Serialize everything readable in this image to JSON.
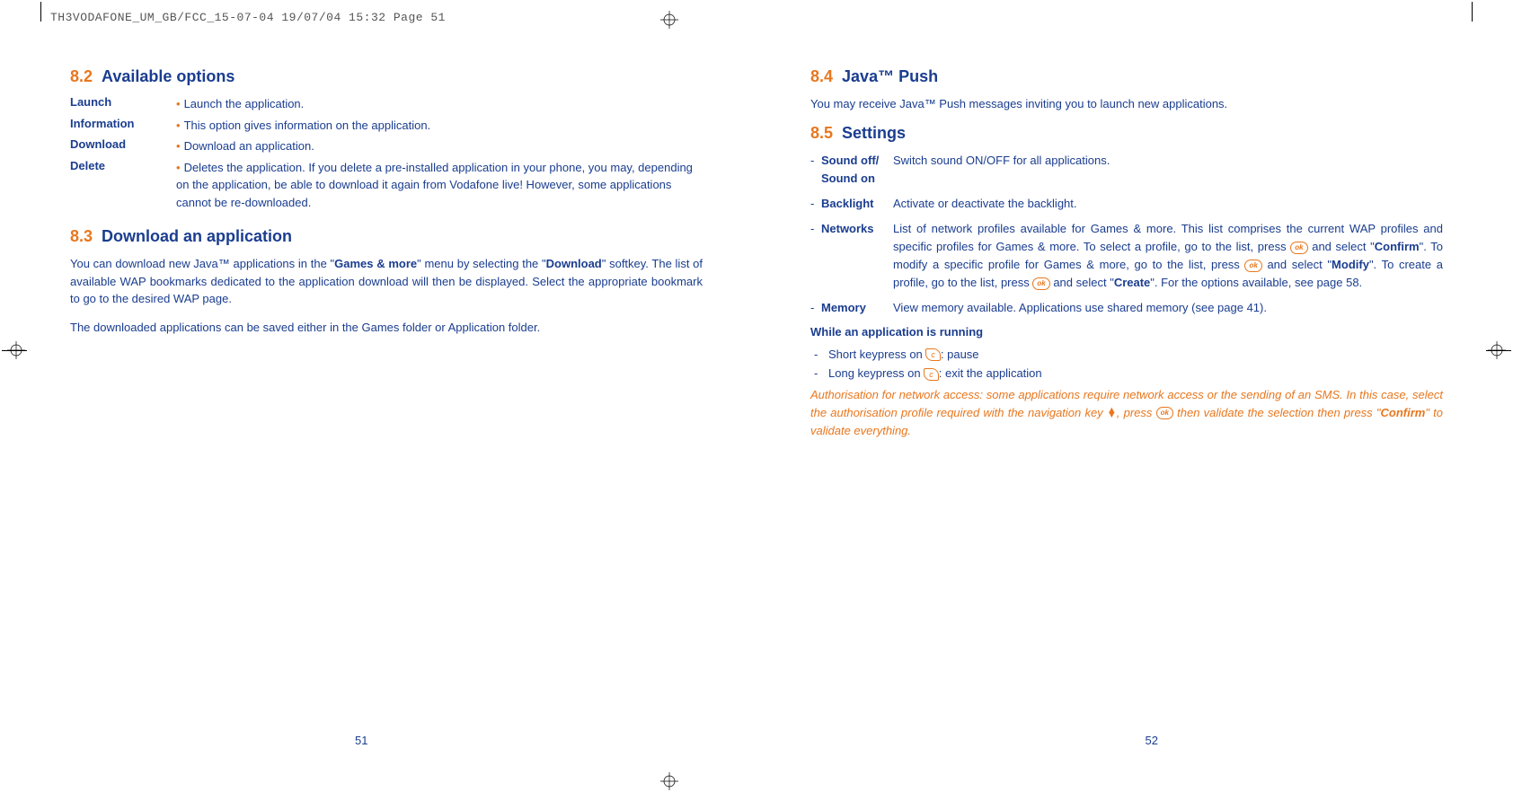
{
  "header": "TH3VODAFONE_UM_GB/FCC_15-07-04  19/07/04  15:32  Page 51",
  "left": {
    "s82": {
      "num": "8.2",
      "title": "Available options"
    },
    "options": [
      {
        "label": "Launch",
        "desc": "Launch the application."
      },
      {
        "label": "Information",
        "desc": "This option gives information on the application."
      },
      {
        "label": "Download",
        "desc": "Download an application."
      },
      {
        "label": "Delete",
        "desc": "Deletes the application. If you delete a pre-installed application in your phone, you may, depending on the application, be able to download it again from Vodafone live! However, some applications cannot be re-downloaded."
      }
    ],
    "s83": {
      "num": "8.3",
      "title": "Download an application"
    },
    "p83a_1": "You can download new Java™ applications in the \"",
    "p83a_b1": "Games & more",
    "p83a_2": "\" menu by selecting the \"",
    "p83a_b2": "Download",
    "p83a_3": "\" softkey. The list of available WAP bookmarks dedicated to the application download will then be displayed. Select the appropriate bookmark to go to the desired WAP page.",
    "p83b": "The downloaded applications can be saved either in the Games folder or Application folder.",
    "page_num": "51"
  },
  "right": {
    "s84": {
      "num": "8.4",
      "title": "Java™ Push"
    },
    "p84": "You may receive Java™ Push messages inviting you to launch new applications.",
    "s85": {
      "num": "8.5",
      "title": "Settings"
    },
    "settings": {
      "sound": {
        "label1": "Sound off/",
        "label2": "Sound on",
        "desc": "Switch sound ON/OFF for all applications."
      },
      "backlight": {
        "label": "Backlight",
        "desc": "Activate or deactivate the backlight."
      },
      "networks": {
        "label": "Networks",
        "d1": "List of network profiles available for Games & more. This list comprises the current WAP profiles and specific profiles for Games & more. To select a profile, go to the list, press ",
        "d2": " and select \"",
        "b1": "Confirm",
        "d3": "\". To modify a specific profile for Games & more, go to the list, press ",
        "d4": " and select \"",
        "b2": "Modify",
        "d5": "\". To create a profile, go to the list, press ",
        "d6": " and select \"",
        "b3": "Create",
        "d7": "\". For the options available, see page 58."
      },
      "memory": {
        "label": "Memory",
        "desc": "View memory available. Applications use shared memory (see page 41)."
      }
    },
    "running_heading": "While an application is running",
    "running": {
      "r1a": "Short keypress on ",
      "r1b": ": pause",
      "r2a": "Long keypress on ",
      "r2b": ": exit the application"
    },
    "footnote": {
      "f1": "Authorisation for network access: some applications require network access or the sending of an SMS. In this case, select the authorisation profile required with the navigation key ",
      "f2": ", press ",
      "f3": " then validate the selection then press \"",
      "fb": "Confirm",
      "f4": "\" to validate everything."
    },
    "page_num": "52"
  },
  "icons": {
    "ok": "ok",
    "c": "c"
  }
}
